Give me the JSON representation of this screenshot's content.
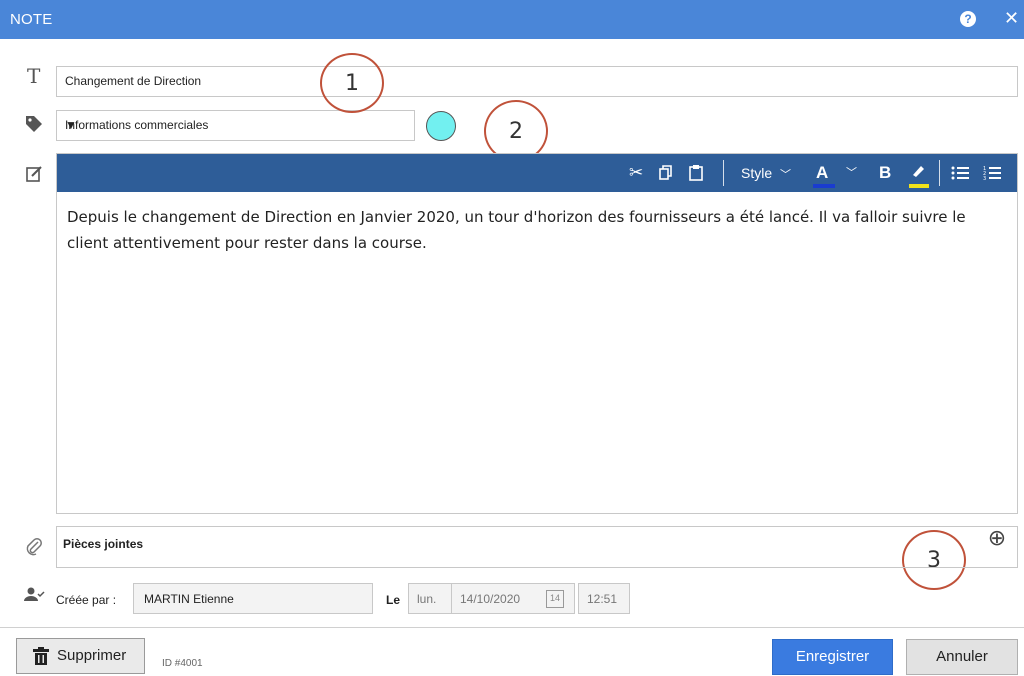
{
  "window": {
    "title": "NOTE",
    "help_icon": "question-icon",
    "close_icon": "close-icon"
  },
  "title_field": {
    "value": "Changement de Direction",
    "icon": "title-T-icon"
  },
  "category": {
    "value": "Informations commerciales",
    "icon": "tag-icon",
    "color": "#72f0f0"
  },
  "editor": {
    "icon": "note-edit-icon",
    "toolbar": {
      "cut": "✂",
      "copy": "⧉",
      "paste": "📋",
      "style_label": "Style",
      "font_color_label": "A",
      "bold_label": "B",
      "font_color": "#1a3cd0",
      "highlight_color": "#f1e21b"
    },
    "content": "Depuis le changement de Direction en Janvier 2020, un tour d'horizon des fournisseurs a été lancé. Il va falloir suivre le client attentivement pour rester dans la course."
  },
  "attachments": {
    "label": "Pièces jointes",
    "icon": "paperclip-icon",
    "add_icon": "plus-circle-icon"
  },
  "created": {
    "icon": "user-check-icon",
    "label": "Créée par :",
    "author": "MARTIN Etienne",
    "on_label": "Le",
    "day": "lun.",
    "date": "14/10/2020",
    "calendar_day": "14",
    "time": "12:51"
  },
  "callouts": [
    "1",
    "2",
    "3"
  ],
  "footer": {
    "delete_label": "Supprimer",
    "id_label": "ID #4001",
    "save_label": "Enregistrer",
    "cancel_label": "Annuler"
  }
}
